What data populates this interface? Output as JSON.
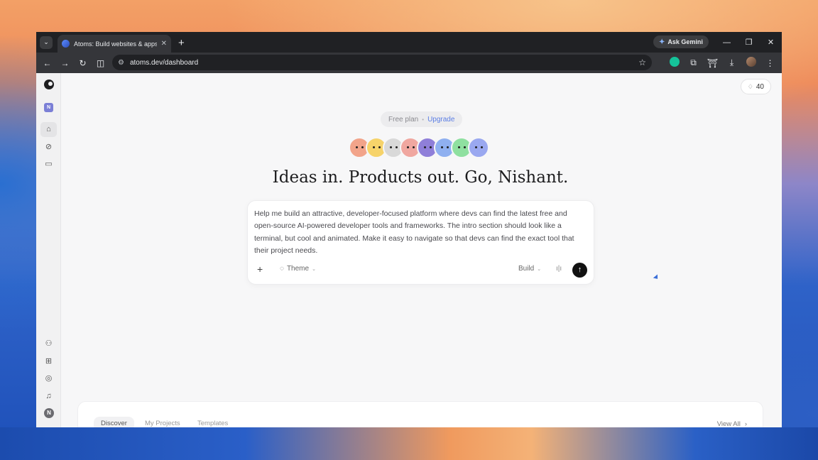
{
  "browser": {
    "tab_title": "Atoms: Build websites & apps i",
    "gemini_label": "Ask Gemini",
    "url": "atoms.dev/dashboard"
  },
  "sidebar": {
    "workspace_initial": "N",
    "user_initial": "N"
  },
  "header": {
    "credits": "40"
  },
  "plan": {
    "label": "Free plan",
    "separator": "•",
    "upgrade": "Upgrade"
  },
  "mascots": [
    {
      "color": "#f2a48a"
    },
    {
      "color": "#f6d36a"
    },
    {
      "color": "#d9d9d9"
    },
    {
      "color": "#f0a7a0"
    },
    {
      "color": "#8f7fd9"
    },
    {
      "color": "#8fb0f0"
    },
    {
      "color": "#8fe0a0"
    },
    {
      "color": "#9aa8f0"
    }
  ],
  "headline": "Ideas in. Products out. Go, Nishant.",
  "prompt": {
    "text": "Help me build an attractive, developer-focused platform where devs can find the latest free and open-source AI-powered developer tools and frameworks. The intro section should look like a terminal, but cool and animated. Make it easy to navigate so that devs can find the exact tool that their project needs.",
    "theme_label": "Theme",
    "build_label": "Build"
  },
  "bottom_tabs": [
    "Discover",
    "My Projects",
    "Templates"
  ],
  "view_all": "View All"
}
